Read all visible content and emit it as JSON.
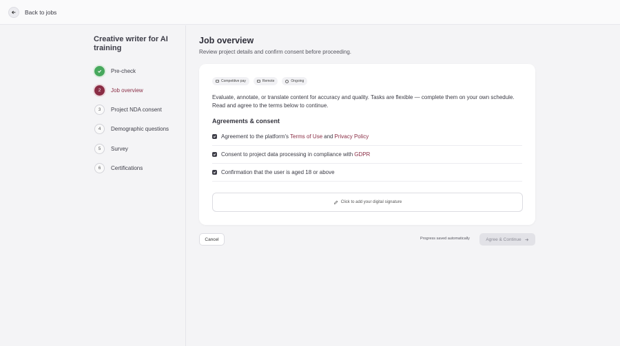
{
  "header": {
    "back_label": "Back to jobs"
  },
  "sidebar": {
    "title": "Creative writer for AI training",
    "steps": [
      {
        "number": "",
        "label": "Pre-check",
        "state": "done"
      },
      {
        "number": "2",
        "label": "Job overview",
        "state": "active"
      },
      {
        "number": "3",
        "label": "Project NDA consent",
        "state": "pending"
      },
      {
        "number": "4",
        "label": "Demographic questions",
        "state": "pending"
      },
      {
        "number": "5",
        "label": "Survey",
        "state": "pending"
      },
      {
        "number": "6",
        "label": "Certifications",
        "state": "pending"
      }
    ]
  },
  "main": {
    "title": "Job overview",
    "subtitle": "Review project details and confirm consent before proceeding.",
    "chips": [
      {
        "label": "Competitive pay",
        "icon": "money-icon"
      },
      {
        "label": "Remote",
        "icon": "monitor-icon"
      },
      {
        "label": "Ongoing",
        "icon": "clock-icon"
      }
    ],
    "description": "Evaluate, annotate, or translate content for accuracy and quality. Tasks are flexible — complete them on your own schedule. Read and agree to the terms below to continue.",
    "agreements_heading": "Agreements & consent",
    "agreements": {
      "row1": {
        "before": "Agreement to the platform's",
        "link1": "Terms of Use",
        "middle": "and",
        "link2": "Privacy Policy"
      },
      "row2": {
        "before": "Consent to project data processing in compliance with",
        "link1": "GDPR"
      },
      "row3": {
        "before": "Confirmation that the user is aged 18 or above"
      }
    },
    "signature_label": "Click to add your digital signature"
  },
  "footer": {
    "cancel_label": "Cancel",
    "progress_note": "Progress saved automatically",
    "continue_label": "Agree & Continue"
  },
  "colors": {
    "accent": "#8a2d45",
    "done": "#47a85d"
  }
}
